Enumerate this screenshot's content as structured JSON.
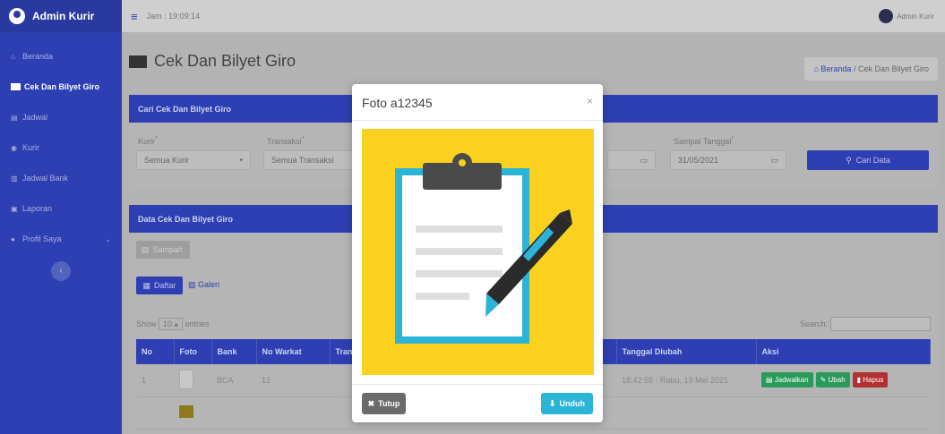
{
  "brand": {
    "title": "Admin Kurir"
  },
  "sidebar": {
    "items": [
      {
        "label": "Beranda"
      },
      {
        "label": "Cek Dan Bilyet Giro"
      },
      {
        "label": "Jadwal"
      },
      {
        "label": "Kurir"
      },
      {
        "label": "Jadwal Bank"
      },
      {
        "label": "Laporan"
      },
      {
        "label": "Profil Saya"
      }
    ],
    "toggle": "‹"
  },
  "topbar": {
    "clock": "Jam : 19:09:14",
    "user": "Admin Kurir"
  },
  "page": {
    "title": "Cek Dan Bilyet Giro",
    "breadcrumb_home": "Beranda",
    "breadcrumb_sep": "/",
    "breadcrumb_current": "Cek Dan Bilyet Giro"
  },
  "search": {
    "header": "Cari Cek Dan Bilyet Giro",
    "kurir_label": "Kurir",
    "kurir_value": "Semua Kurir",
    "transaksi_label": "Transaksi",
    "transaksi_value": "Semua Transaksi",
    "sampai_label": "Sampai Tanggal",
    "sampai_value": "31/05/2021",
    "button": "Cari Data",
    "required_mark": "*"
  },
  "data": {
    "header": "Data Cek Dan Bilyet Giro",
    "trash_button": "Sampah",
    "tab_list": "Daftar",
    "tab_gallery": "Galeri",
    "show_label": "Show",
    "show_value": "10",
    "entries_label": "entries",
    "search_label": "Search:",
    "columns": [
      "No",
      "Foto",
      "Bank",
      "No Warkat",
      "Tran",
      "Tanggal Diubah",
      "Aksi"
    ],
    "rows": [
      {
        "no": "1",
        "bank": "BCA",
        "warkat": "12",
        "tanggal": "18:42:58 - Rabu, 19 Mei 2021"
      }
    ],
    "actions": {
      "jadwal": "Jadwalkan",
      "ubah": "Ubah",
      "hapus": "Hapus"
    }
  },
  "modal": {
    "title": "Foto a12345",
    "close_x": "×",
    "close_button": "Tutup",
    "download_button": "Unduh"
  },
  "colors": {
    "primary": "#2e3fb3",
    "photo_bg": "#fad11e",
    "download": "#2bb4d6"
  }
}
